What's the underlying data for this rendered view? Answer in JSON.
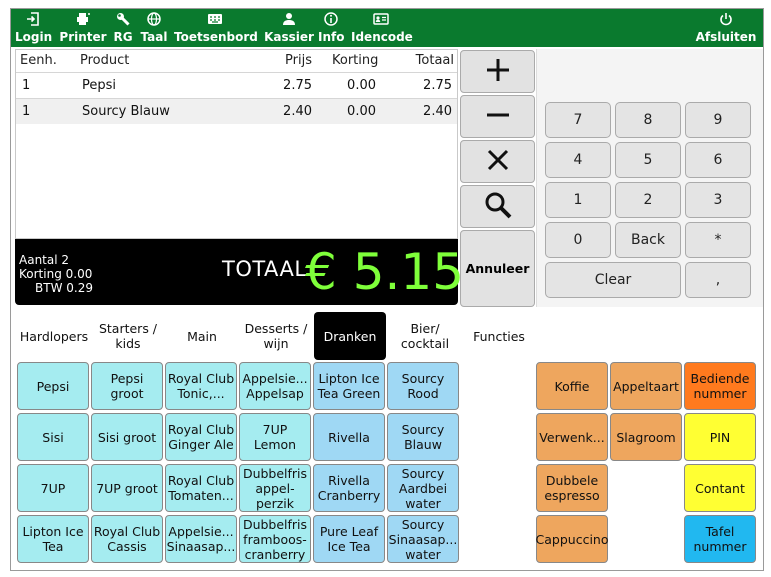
{
  "colors": {
    "toolbar_bg": "#0a7a2e",
    "total_amount": "#7fff3a",
    "product_light": "#a5ecf0",
    "product_blue": "#9fd8f4",
    "function_orange": "#eea65e",
    "function_yellow": "#ffff33",
    "bediende": "#ff7a1e",
    "tafel": "#21b8f0"
  },
  "toolbar": {
    "login": {
      "label": "Login",
      "icon": "login-icon"
    },
    "printer": {
      "label": "Printer",
      "icon": "printer-icon"
    },
    "rg": {
      "label": "RG",
      "icon": "wrench-icon"
    },
    "taal": {
      "label": "Taal",
      "icon": "globe-icon"
    },
    "toetsenbord": {
      "label": "Toetsenbord",
      "icon": "keyboard-icon"
    },
    "kassier": {
      "label": "Kassier",
      "icon": "user-icon"
    },
    "info": {
      "label": "Info",
      "icon": "info-icon"
    },
    "idencode": {
      "label": "Idencode",
      "icon": "id-card-icon"
    },
    "afsluiten": {
      "label": "Afsluiten",
      "icon": "power-icon"
    }
  },
  "order": {
    "headers": {
      "eenh": "Eenh.",
      "product": "Product",
      "prijs": "Prijs",
      "korting": "Korting",
      "totaal": "Totaal"
    },
    "rows": [
      {
        "eenh": "1",
        "product": "Pepsi",
        "prijs": "2.75",
        "korting": "0.00",
        "totaal": "2.75"
      },
      {
        "eenh": "1",
        "product": "Sourcy Blauw",
        "prijs": "2.40",
        "korting": "0.00",
        "totaal": "2.40"
      }
    ]
  },
  "summary": {
    "aantal": "Aantal 2",
    "korting": "Korting 0.00",
    "btw": "BTW 0.29",
    "totaal_label": "TOTAAL",
    "totaal_amount": "€ 5.15"
  },
  "actions": {
    "plus": "plus-icon",
    "minus": "minus-icon",
    "remove": "close-icon",
    "search": "search-icon",
    "annuleer": "Annuleer"
  },
  "keypad": {
    "k7": "7",
    "k8": "8",
    "k9": "9",
    "k4": "4",
    "k5": "5",
    "k6": "6",
    "k1": "1",
    "k2": "2",
    "k3": "3",
    "k0": "0",
    "back": "Back",
    "star": "*",
    "clear": "Clear",
    "comma": ","
  },
  "categories": {
    "hardlopers": "Hardlopers",
    "starters": "Starters / kids",
    "main": "Main",
    "desserts": "Desserts / wijn",
    "dranken": "Dranken",
    "bier": "Bier/ cocktail",
    "functies": "Functies"
  },
  "products": {
    "pepsi": "Pepsi",
    "pepsi_groot": "Pepsi groot",
    "royal_tonic": "Royal Club Tonic,...",
    "appelsie_appelsap": "Appelsie... Appelsap",
    "lipton_green": "Lipton Ice Tea Green",
    "sourcy_rood": "Sourcy Rood",
    "sisi": "Sisi",
    "sisi_groot": "Sisi groot",
    "royal_ginger": "Royal Club Ginger Ale",
    "seven_up_lemon": "7UP Lemon",
    "rivella": "Rivella",
    "sourcy_blauw": "Sourcy Blauw",
    "seven_up": "7UP",
    "seven_up_groot": "7UP groot",
    "royal_tomaten": "Royal Club Tomaten...",
    "dubbelfris_perzik": "Dubbelfris appel-perzik",
    "rivella_cranberry": "Rivella Cranberry",
    "sourcy_aardbei": "Sourcy Aardbei water",
    "lipton_tea": "Lipton Ice Tea",
    "royal_cassis": "Royal Club Cassis",
    "appelsie_sinaasap": "Appelsie... Sinaasap...",
    "dubbelfris_framboos": "Dubbelfris framboos-cranberry",
    "pure_leaf": "Pure Leaf Ice Tea",
    "sourcy_sinaas": "Sourcy Sinaasap... water"
  },
  "functions": {
    "koffie": "Koffie",
    "appeltaart": "Appeltaart",
    "bediende": "Bediende nummer",
    "verwenk": "Verwenk...",
    "slagroom": "Slagroom",
    "pin": "PIN",
    "dubbele_espresso": "Dubbele espresso",
    "contant": "Contant",
    "cappuccino": "Cappuccino",
    "tafel": "Tafel nummer"
  }
}
